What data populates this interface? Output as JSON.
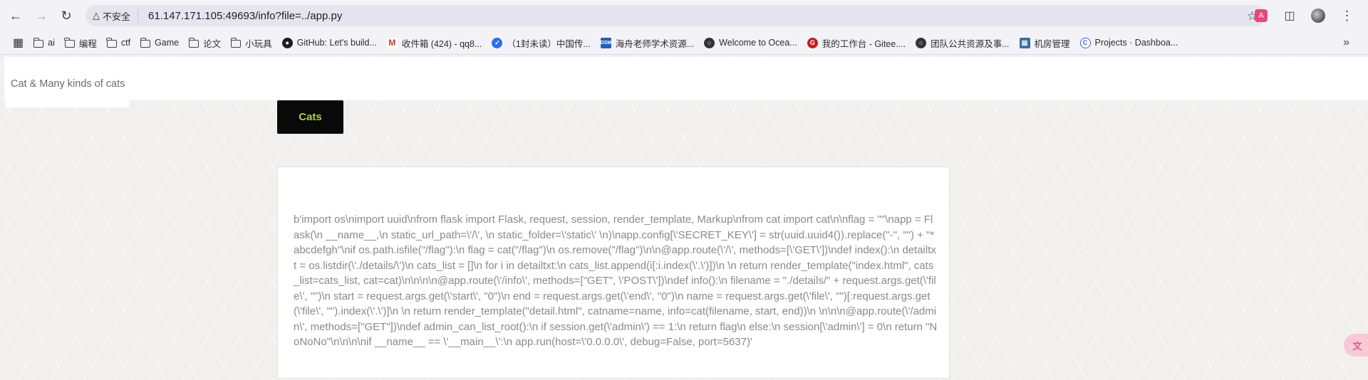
{
  "browser": {
    "security_label": "不安全",
    "url": "61.147.171.105:49693/info?file=../app.py",
    "bookmarks": [
      {
        "label": "ai",
        "icon": "folder-icon"
      },
      {
        "label": "编程",
        "icon": "folder-icon"
      },
      {
        "label": "ctf",
        "icon": "folder-icon"
      },
      {
        "label": "Game",
        "icon": "folder-icon"
      },
      {
        "label": "论文",
        "icon": "folder-icon"
      },
      {
        "label": "小玩具",
        "icon": "folder-icon"
      },
      {
        "label": "GitHub: Let's build...",
        "icon": "github-icon"
      },
      {
        "label": "收件箱 (424) - qq8...",
        "icon": "gmail-icon"
      },
      {
        "label": "（1封未读）中国传...",
        "icon": "mail-icon"
      },
      {
        "label": "海舟老师学术资源...",
        "icon": "dsm-icon"
      },
      {
        "label": "Welcome to Ocea...",
        "icon": "globe-icon"
      },
      {
        "label": "我的工作台 - Gitee....",
        "icon": "gitee-icon"
      },
      {
        "label": "团队公共资源及事...",
        "icon": "globe-icon"
      },
      {
        "label": "机房管理",
        "icon": "server-icon"
      },
      {
        "label": "Projects · Dashboa...",
        "icon": "projects-icon"
      }
    ],
    "ext_badge": "A"
  },
  "site": {
    "title": "Cat & Many kinds of cats",
    "nav_button": "Cats",
    "content": "b'import os\\nimport uuid\\nfrom flask import Flask, request, session, render_template, Markup\\nfrom cat import cat\\n\\nflag = \"\"\\napp = Flask(\\n __name__,\\n static_url_path=\\'/\\', \\n static_folder=\\'static\\' \\n)\\napp.config[\\'SECRET_KEY\\'] = str(uuid.uuid4()).replace(\"-\", \"\") + \"*abcdefgh\"\\nif os.path.isfile(\"/flag\"):\\n flag = cat(\"/flag\")\\n os.remove(\"/flag\")\\n\\n@app.route(\\'/\\', methods=[\\'GET\\'])\\ndef index():\\n detailtxt = os.listdir(\\'./details/\\')\\n cats_list = []\\n for i in detailtxt:\\n cats_list.append(i[:i.index(\\'.\\')])\\n \\n return render_template(\"index.html\", cats_list=cats_list, cat=cat)\\n\\n\\n\\n@app.route(\\'/info\\', methods=[\"GET\", \\'POST\\'])\\ndef info():\\n filename = \"./details/\" + request.args.get(\\'file\\', \"\")\\n start = request.args.get(\\'start\\', \"0\")\\n end = request.args.get(\\'end\\', \"0\")\\n name = request.args.get(\\'file\\', \"\")[:request.args.get(\\'file\\', \"\").index(\\'.\\')]\\n \\n return render_template(\"detail.html\", catname=name, info=cat(filename, start, end))\\n \\n\\n\\n@app.route(\\'/admin\\', methods=[\"GET\"])\\ndef admin_can_list_root():\\n if session.get(\\'admin\\') == 1:\\n return flag\\n else:\\n session[\\'admin\\'] = 0\\n return \"NoNoNo\"\\n\\n\\n\\nif __name__ == \\'__main__\\':\\n app.run(host=\\'0.0.0.0\\', debug=False, port=5637)'"
  },
  "colors": {
    "nav_button_bg": "#090909",
    "nav_button_text": "#a9d437",
    "content_text": "#8a8a8a"
  }
}
